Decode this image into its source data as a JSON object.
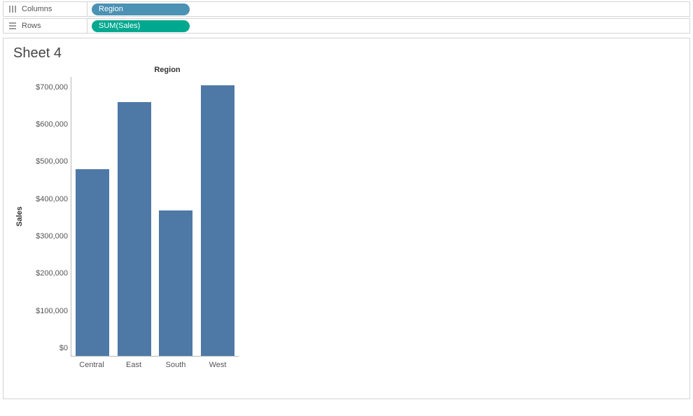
{
  "shelves": {
    "columns_label": "Columns",
    "rows_label": "Rows",
    "columns_pill": "Region",
    "rows_pill": "SUM(Sales)"
  },
  "sheet": {
    "title": "Sheet 4"
  },
  "chart_data": {
    "type": "bar",
    "title": "Region",
    "xlabel": "",
    "ylabel": "Sales",
    "ylim": [
      0,
      750000
    ],
    "y_ticks": [
      "$0",
      "$100,000",
      "$200,000",
      "$300,000",
      "$400,000",
      "$500,000",
      "$600,000",
      "$700,000"
    ],
    "categories": [
      "Central",
      "East",
      "South",
      "West"
    ],
    "values": [
      500000,
      680000,
      390000,
      725000
    ]
  }
}
